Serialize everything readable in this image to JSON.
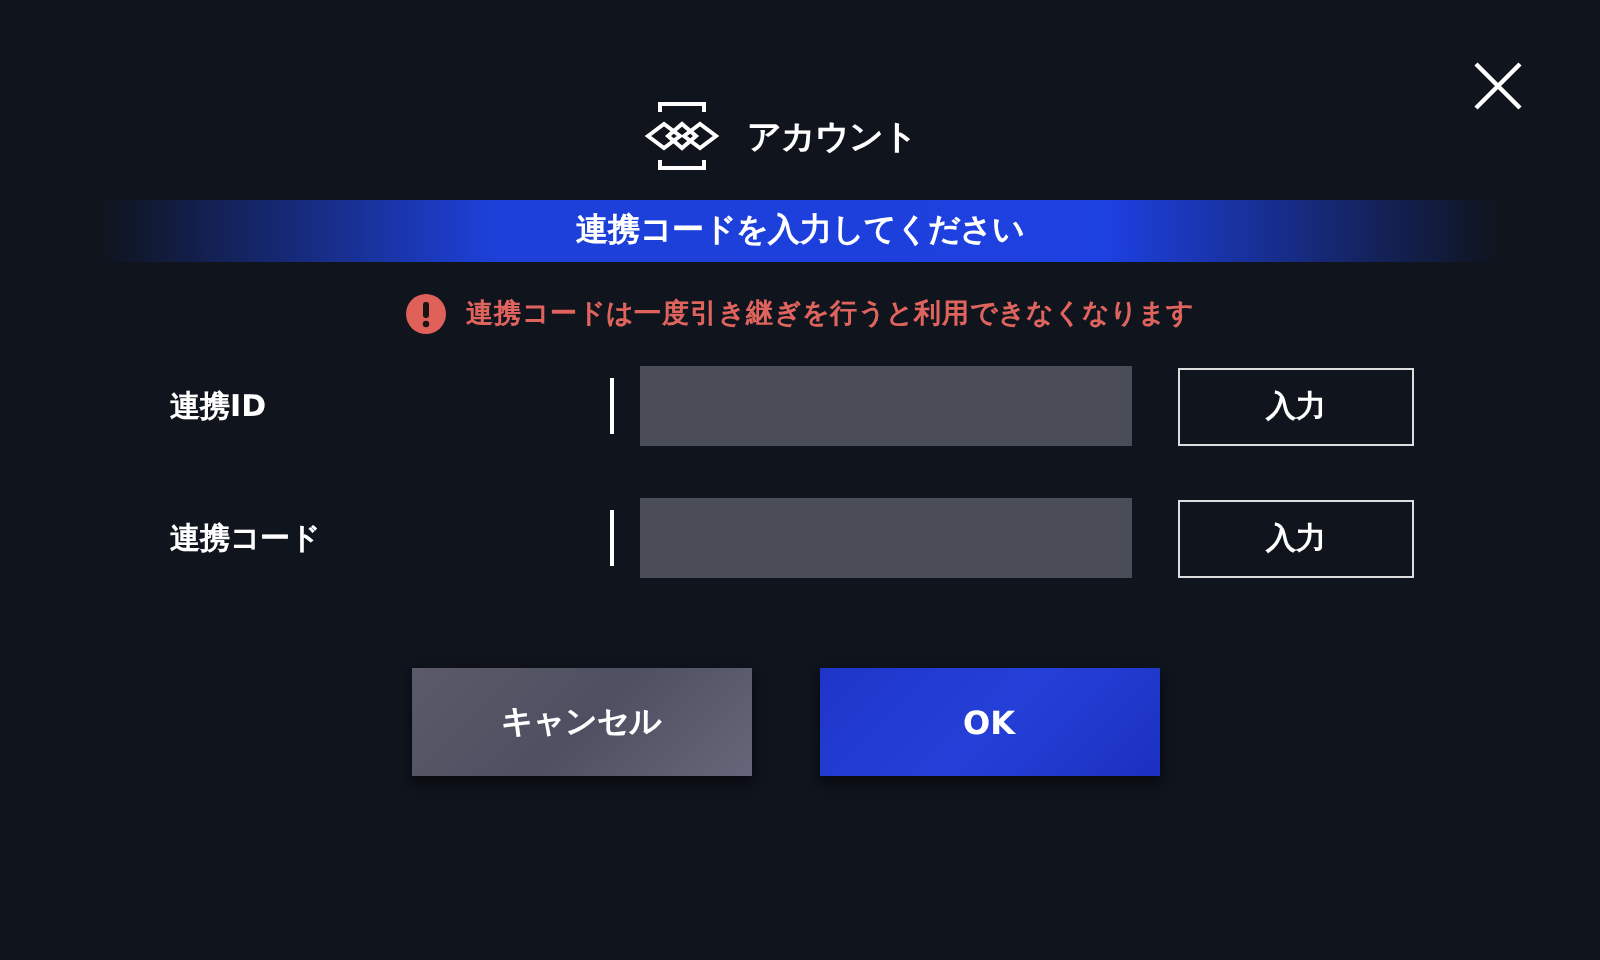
{
  "header": {
    "title": "アカウント"
  },
  "banner": {
    "text": "連携コードを入力してください"
  },
  "warning": {
    "text": "連携コードは一度引き継ぎを行うと利用できなくなります"
  },
  "fields": [
    {
      "label": "連携ID",
      "button": "入力"
    },
    {
      "label": "連携コード",
      "button": "入力"
    }
  ],
  "buttons": [
    {
      "kind": "cancel",
      "label": "キャンセル"
    },
    {
      "kind": "ok",
      "label": "OK"
    }
  ]
}
